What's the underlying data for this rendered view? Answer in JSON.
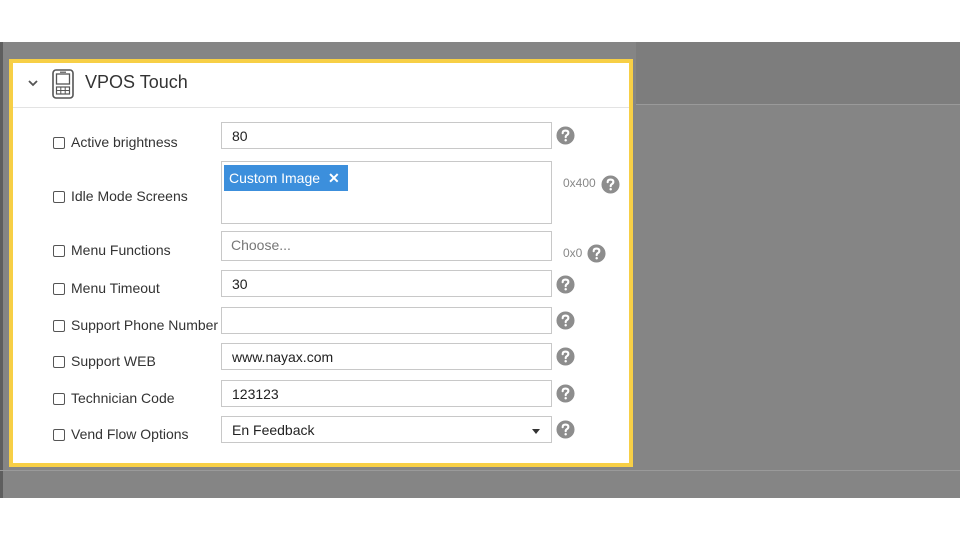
{
  "section": {
    "title": "VPOS Touch"
  },
  "fields": {
    "active_brightness": {
      "label": "Active brightness",
      "value": "80"
    },
    "idle_mode_screens": {
      "label": "Idle Mode Screens",
      "tag": "Custom Image",
      "tag_remove": "✕",
      "suffix": "0x400"
    },
    "menu_functions": {
      "label": "Menu Functions",
      "placeholder": "Choose...",
      "suffix": "0x0"
    },
    "menu_timeout": {
      "label": "Menu Timeout",
      "value": "30"
    },
    "support_phone_number": {
      "label": "Support Phone Number",
      "value": ""
    },
    "support_web": {
      "label": "Support WEB",
      "value": "www.nayax.com"
    },
    "technician_code": {
      "label": "Technician Code",
      "value": "123123"
    },
    "vend_flow_options": {
      "label": "Vend Flow Options",
      "selected": "En Feedback"
    }
  },
  "icons": {
    "collapse": "chevron-down-icon",
    "device": "vpos-device-icon",
    "help": "help-circle-icon",
    "remove": "close-icon",
    "dropdown": "caret-down-icon"
  },
  "colors": {
    "highlight_border": "#f7cf46",
    "tag_bg": "#3c8fdc",
    "help_icon": "#8d8d8d",
    "overlay": "#858585"
  }
}
